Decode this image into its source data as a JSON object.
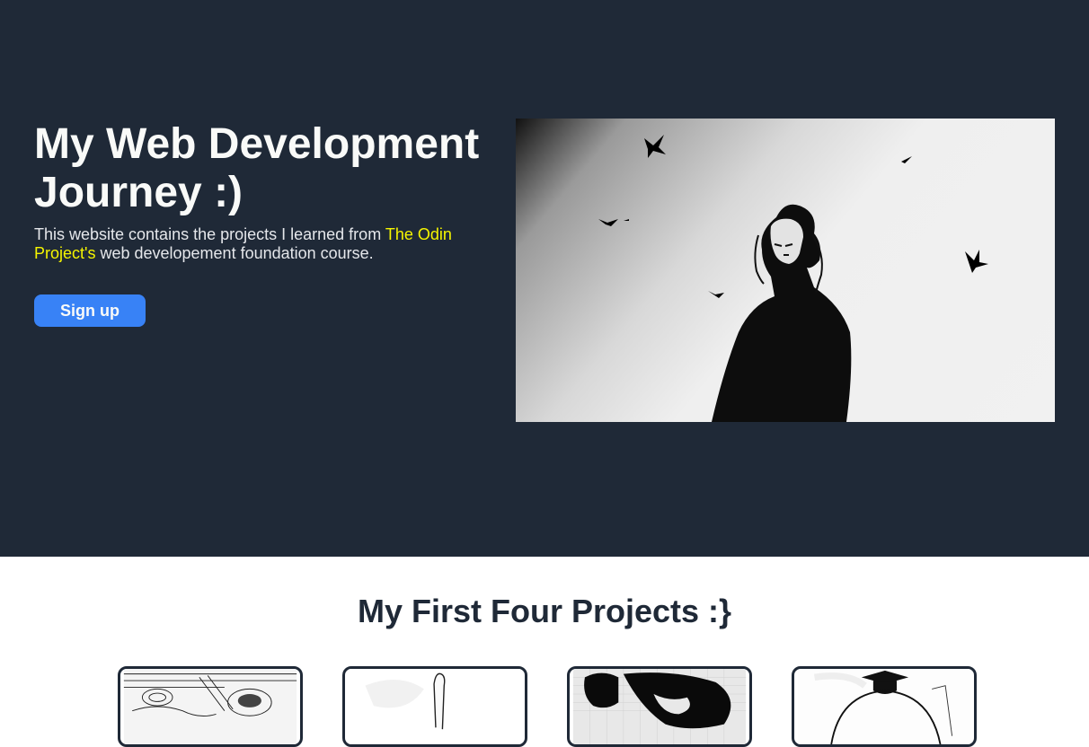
{
  "hero": {
    "title": "My Web Development Journey :)",
    "description_before": "This website contains the projects I learned from ",
    "description_link": "The Odin Project's",
    "description_after": " web developement foundation course.",
    "signup_label": "Sign up"
  },
  "projects": {
    "title": "My First Four Projects :}",
    "cards": [
      {
        "image": "manga-food-bowl-image"
      },
      {
        "image": "manga-hand-image"
      },
      {
        "image": "manga-pixel-portrait-image"
      },
      {
        "image": "manga-graduate-cap-image"
      }
    ]
  },
  "colors": {
    "hero_background": "#1f2937",
    "accent_link": "#f5f500",
    "button": "#3882f6",
    "heading_dark": "#1f2937"
  }
}
